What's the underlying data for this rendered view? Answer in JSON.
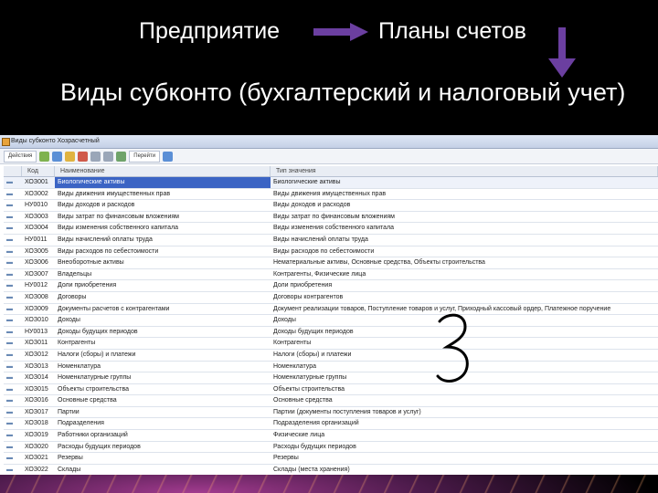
{
  "slide": {
    "enterprise": "Предприятие",
    "charts": "Планы счетов",
    "heading": "Виды субконто (бухгалтерский и налоговый учет)",
    "handwritten": "3"
  },
  "colors": {
    "arrow": "#6b3fa0",
    "selection": "#3b64c4"
  },
  "window": {
    "title": "Виды субконто Хозрасчетный",
    "actions_label": "Действия",
    "goto_label": "Перейти"
  },
  "columns": {
    "code": "Код",
    "name": "Наименование",
    "full": "Тип значения"
  },
  "rows": [
    {
      "code": "ХОЗ001",
      "name": "Биологические активы",
      "full": "Биологические активы"
    },
    {
      "code": "ХОЗ002",
      "name": "Виды движения имущественных прав",
      "full": "Виды движения имущественных прав"
    },
    {
      "code": "НУ0010",
      "name": "Виды доходов и расходов",
      "full": "Виды доходов и расходов"
    },
    {
      "code": "ХОЗ003",
      "name": "Виды затрат по финансовым вложениям",
      "full": "Виды затрат по финансовым вложениям"
    },
    {
      "code": "ХОЗ004",
      "name": "Виды изменения собственного капитала",
      "full": "Виды изменения собственного капитала"
    },
    {
      "code": "НУ0011",
      "name": "Виды начислений оплаты труда",
      "full": "Виды начислений оплаты труда"
    },
    {
      "code": "ХОЗ005",
      "name": "Виды расходов по себестоимости",
      "full": "Виды расходов по себестоимости"
    },
    {
      "code": "ХОЗ006",
      "name": "Внеоборотные активы",
      "full": "Нематериальные активы, Основные средства, Объекты строительства"
    },
    {
      "code": "ХОЗ007",
      "name": "Владельцы",
      "full": "Контрагенты, Физические лица"
    },
    {
      "code": "НУ0012",
      "name": "Доли приобретения",
      "full": "Доли приобретения"
    },
    {
      "code": "ХОЗ008",
      "name": "Договоры",
      "full": "Договоры контрагентов"
    },
    {
      "code": "ХОЗ009",
      "name": "Документы расчетов с контрагентами",
      "full": "Документ реализации товаров, Поступление товаров и услуг, Приходный кассовый ордер, Платежное поручение"
    },
    {
      "code": "ХОЗ010",
      "name": "Доходы",
      "full": "Доходы"
    },
    {
      "code": "НУ0013",
      "name": "Доходы будущих периодов",
      "full": "Доходы будущих периодов"
    },
    {
      "code": "ХОЗ011",
      "name": "Контрагенты",
      "full": "Контрагенты"
    },
    {
      "code": "ХОЗ012",
      "name": "Налоги (сборы) и платежи",
      "full": "Налоги (сборы) и платежи"
    },
    {
      "code": "ХОЗ013",
      "name": "Номенклатура",
      "full": "Номенклатура"
    },
    {
      "code": "ХОЗ014",
      "name": "Номенклатурные группы",
      "full": "Номенклатурные группы"
    },
    {
      "code": "ХОЗ015",
      "name": "Объекты строительства",
      "full": "Объекты строительства"
    },
    {
      "code": "ХОЗ016",
      "name": "Основные средства",
      "full": "Основные средства"
    },
    {
      "code": "ХОЗ017",
      "name": "Партии",
      "full": "Партии (документы поступления товаров и услуг)"
    },
    {
      "code": "ХОЗ018",
      "name": "Подразделения",
      "full": "Подразделения организаций"
    },
    {
      "code": "ХОЗ019",
      "name": "Работники организаций",
      "full": "Физические лица"
    },
    {
      "code": "ХОЗ020",
      "name": "Расходы будущих периодов",
      "full": "Расходы будущих периодов"
    },
    {
      "code": "ХОЗ021",
      "name": "Резервы",
      "full": "Резервы"
    },
    {
      "code": "ХОЗ022",
      "name": "Склады",
      "full": "Склады (места хранения)"
    }
  ]
}
